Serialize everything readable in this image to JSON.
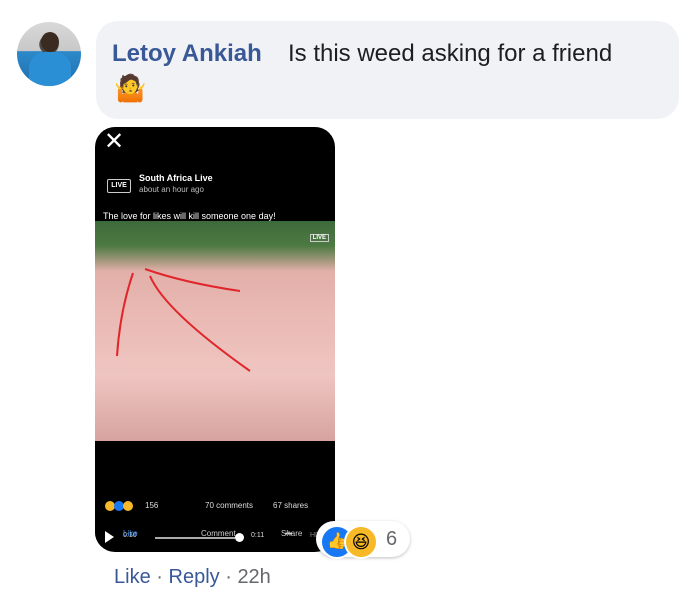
{
  "comment": {
    "author": "Letoy Ankiah",
    "text": "Is this weed asking for a friend",
    "emoji": "🤷"
  },
  "post_preview": {
    "close_glyph": "✕",
    "page_logo": "LIVE",
    "page_name": "South Africa Live",
    "time": "about an hour ago",
    "caption": "The love for likes will kill someone one day!",
    "live_badge": "LIVE",
    "video": {
      "current_time": "0:10",
      "end_time": "0:11",
      "more": "•••",
      "hd": "HD",
      "progress": 0.95
    },
    "stats": {
      "reactions_count": "156",
      "comments": "70 comments",
      "shares": "67 shares"
    },
    "actions": {
      "like": "Like",
      "comment": "Comment",
      "share": "Share"
    }
  },
  "reactions": {
    "count": "6",
    "types": [
      "like-icon",
      "haha-icon"
    ]
  },
  "footer": {
    "like": "Like",
    "separator": "·",
    "reply": "Reply",
    "time": "22h"
  },
  "colors": {
    "author": "#385898",
    "bubble": "#f0f2f5",
    "meta": "#65676b",
    "like_blue": "#1877f2"
  }
}
